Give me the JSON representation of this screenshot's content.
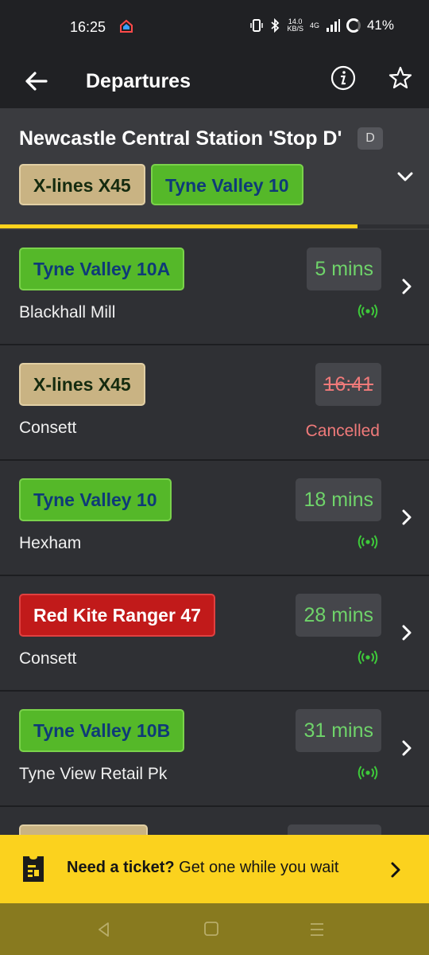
{
  "status_bar": {
    "time": "16:25",
    "net_speed_value": "14.0",
    "net_speed_unit": "KB/S",
    "network": "4G",
    "battery": "41%"
  },
  "app_bar": {
    "title": "Departures"
  },
  "stop": {
    "name": "Newcastle Central Station 'Stop D'",
    "letter": "D",
    "filters": [
      {
        "label": "X-lines X45",
        "color": "khaki"
      },
      {
        "label": "Tyne Valley 10",
        "color": "green"
      }
    ]
  },
  "departures": [
    {
      "route": "Tyne Valley 10A",
      "destination": "Blackhall Mill",
      "time": "5 mins",
      "status": "live"
    },
    {
      "route": "X-lines X45",
      "destination": "Consett",
      "time": "16:41",
      "status": "Cancelled"
    },
    {
      "route": "Tyne Valley 10",
      "destination": "Hexham",
      "time": "18 mins",
      "status": "live"
    },
    {
      "route": "Red Kite Ranger 47",
      "destination": "Consett",
      "time": "28 mins",
      "status": "live"
    },
    {
      "route": "Tyne Valley 10B",
      "destination": "Tyne View Retail Pk",
      "time": "31 mins",
      "status": "live"
    }
  ],
  "ticket_banner": {
    "bold": "Need a ticket?",
    "text": " Get one while you wait"
  },
  "colors": {
    "accent_yellow": "#fbd21e",
    "live_green": "#6fd46a",
    "cancel_red": "#f07a7a"
  },
  "icons": [
    "back-arrow-icon",
    "info-icon",
    "star-icon",
    "chevron-down-icon",
    "chevron-right-icon",
    "live-signal-icon",
    "ticket-icon"
  ]
}
